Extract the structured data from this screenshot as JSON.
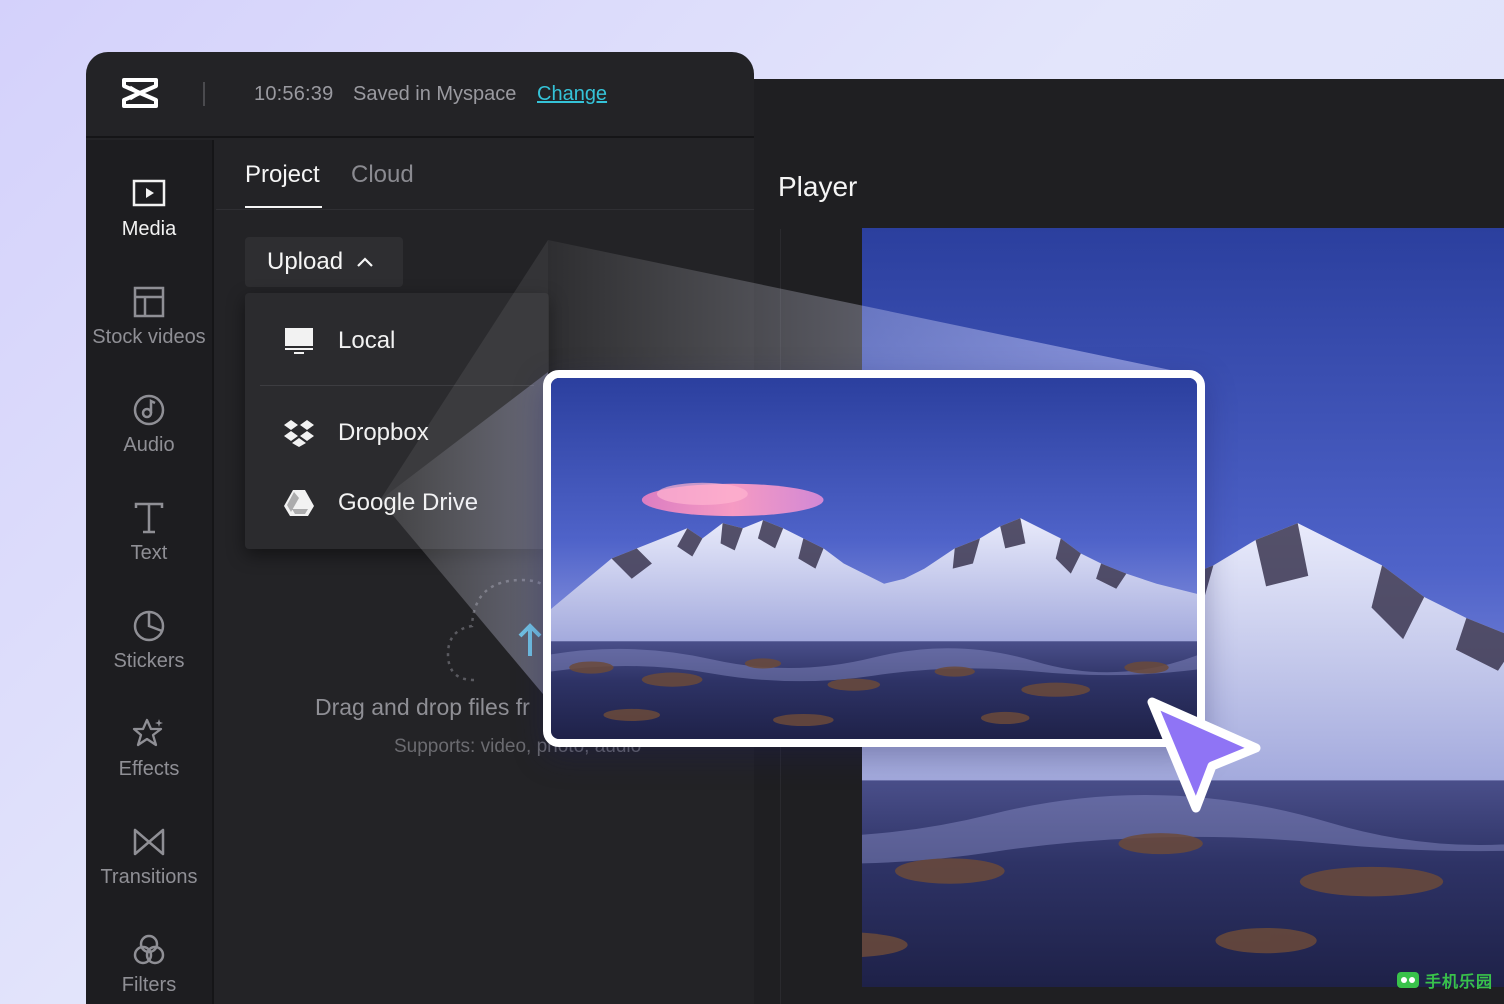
{
  "header": {
    "save_time": "10:56:39",
    "save_status": "Saved in Myspace",
    "change_link": "Change"
  },
  "sidebar": {
    "items": [
      {
        "label": "Media",
        "icon": "media-icon",
        "active": true
      },
      {
        "label": "Stock videos",
        "icon": "stock-videos-icon"
      },
      {
        "label": "Audio",
        "icon": "audio-icon"
      },
      {
        "label": "Text",
        "icon": "text-icon"
      },
      {
        "label": "Stickers",
        "icon": "stickers-icon"
      },
      {
        "label": "Effects",
        "icon": "effects-icon"
      },
      {
        "label": "Transitions",
        "icon": "transitions-icon"
      },
      {
        "label": "Filters",
        "icon": "filters-icon"
      }
    ]
  },
  "tabs": [
    {
      "label": "Project",
      "active": true
    },
    {
      "label": "Cloud"
    }
  ],
  "upload": {
    "button_label": "Upload",
    "menu": [
      {
        "label": "Local",
        "icon": "monitor-icon"
      },
      {
        "label": "Dropbox",
        "icon": "dropbox-icon"
      },
      {
        "label": "Google Drive",
        "icon": "google-drive-icon"
      }
    ]
  },
  "dropzone": {
    "text": "Drag and drop files fr",
    "subtext": "Supports: video, photo, audio"
  },
  "player": {
    "title": "Player"
  },
  "watermark": {
    "text": "手机乐园"
  },
  "colors": {
    "accent_link": "#35c3d8",
    "cursor": "#8f74f5",
    "panel": "#232326",
    "sidebar": "#1d1d20"
  }
}
